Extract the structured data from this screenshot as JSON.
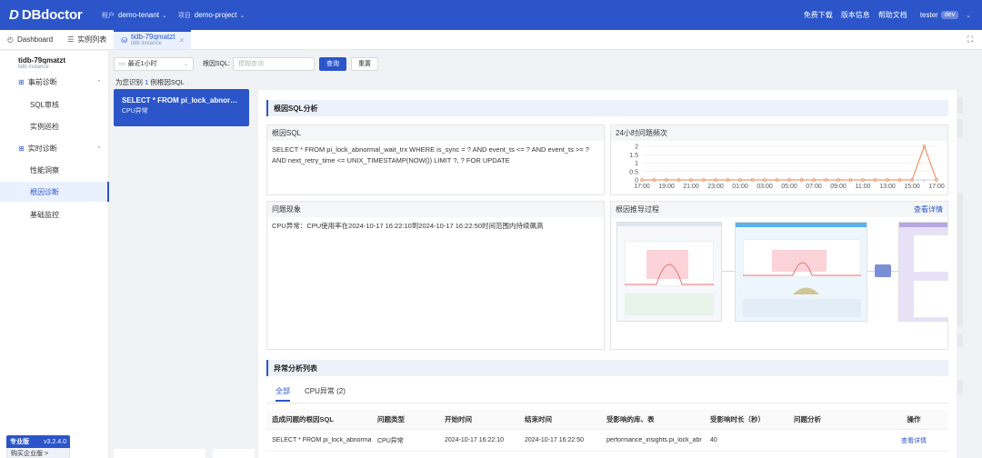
{
  "topbar": {
    "logo": "DBdoctor",
    "tenant_label": "租户",
    "tenant_value": "demo-tenant",
    "project_label": "项目",
    "project_value": "demo-project",
    "links": [
      "免费下载",
      "版本信息",
      "帮助文档"
    ],
    "user": "tester",
    "user_badge": "dev"
  },
  "tabs": {
    "dashboard": "Dashboard",
    "instances": "实例列表",
    "active_title": "tidb-79qmatzt",
    "active_sub": "tidb instance"
  },
  "sidebar": {
    "instance_name": "tidb-79qmatzt",
    "instance_type": "tidb instance",
    "group1": "事前诊断",
    "group1_items": [
      "SQL审核",
      "实例巡检"
    ],
    "group2": "实时诊断",
    "group2_items": [
      "性能洞察",
      "根因诊断",
      "基础监控"
    ],
    "edition_name": "专业版",
    "edition_version": "v3.2.4.0",
    "edition_buy": "购买企业版 >"
  },
  "filter": {
    "time_range": "最近1小时",
    "sql_label": "根因SQL:",
    "sql_placeholder": "模糊查询",
    "query_btn": "查询",
    "reset_btn": "重置"
  },
  "identified": {
    "prefix": "为您识别",
    "count": "1",
    "suffix": "例根因SQL"
  },
  "sql_list": [
    {
      "title": "SELECT * FROM pi_lock_abnormal_...",
      "subtitle": "CPU异常"
    }
  ],
  "analysis": {
    "section_title": "根因SQL分析",
    "root_sql_title": "根因SQL",
    "root_sql_text": "SELECT * FROM pi_lock_abnormal_wait_trx WHERE is_sync = ? AND event_ts <= ? AND event_ts >= ? AND next_retry_time <= UNIX_TIMESTAMP(NOW()) LIMIT ?, ? FOR UPDATE",
    "freq_title": "24小时问题频次",
    "phenomenon_title": "问题现象",
    "phenomenon_text": "CPU异常：CPU使用率在2024-10-17 16:22:10到2024-10-17 16:22:50时间范围内持续飙高",
    "derivation_title": "根因推导过程",
    "derivation_more": "查看详情"
  },
  "chart_data": {
    "type": "line",
    "title": "",
    "x": [
      "17:00",
      "18:00",
      "19:00",
      "20:00",
      "21:00",
      "22:00",
      "23:00",
      "00:00",
      "01:00",
      "02:00",
      "03:00",
      "04:00",
      "05:00",
      "06:00",
      "07:00",
      "08:00",
      "09:00",
      "10:00",
      "11:00",
      "12:00",
      "13:00",
      "14:00",
      "15:00",
      "16:00",
      "17:00"
    ],
    "xticks": [
      "17:00",
      "19:00",
      "21:00",
      "23:00",
      "01:00",
      "03:00",
      "05:00",
      "07:00",
      "09:00",
      "11:00",
      "13:00",
      "15:00",
      "17:00"
    ],
    "values": [
      0,
      0,
      0,
      0,
      0,
      0,
      0,
      0,
      0,
      0,
      0,
      0,
      0,
      0,
      0,
      0,
      0,
      0,
      0,
      0,
      0,
      0,
      0,
      2,
      0
    ],
    "yticks": [
      "0",
      "0.5",
      "1",
      "1.5",
      "2"
    ],
    "ylim": [
      0,
      2
    ],
    "grid": true,
    "color": "#f07c4a"
  },
  "anomaly": {
    "section_title": "异常分析列表",
    "tabs": [
      "全部",
      "CPU异常 (2)"
    ],
    "columns": [
      "造成问题的根因SQL",
      "问题类型",
      "开始时间",
      "结束时间",
      "受影响的库、表",
      "受影响时长（秒）",
      "问题分析",
      "操作"
    ],
    "rows": [
      [
        "SELECT * FROM pi_lock_abnormal_",
        "CPU异常",
        "2024-10-17 16:22:10",
        "2024-10-17 16:22:50",
        "performance_insights.pi_lock_abr",
        "40",
        "",
        "查看详情"
      ]
    ]
  },
  "colors": {
    "brand": "#2b55c9",
    "accent_line": "#f07c4a"
  }
}
